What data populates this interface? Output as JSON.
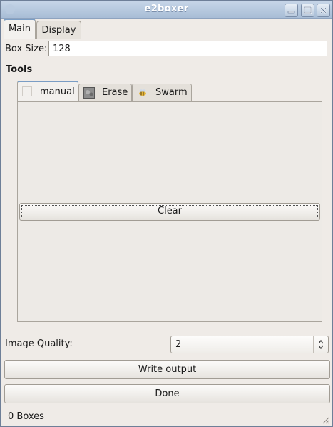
{
  "window": {
    "title": "e2boxer"
  },
  "tabs": [
    {
      "label": "Main"
    },
    {
      "label": "Display"
    }
  ],
  "box_size": {
    "label": "Box Size:",
    "value": "128"
  },
  "tools": {
    "heading": "Tools",
    "tabs": [
      {
        "label": "manual",
        "icon": "blank-icon"
      },
      {
        "label": "Erase",
        "icon": "eraser-image-icon"
      },
      {
        "label": "Swarm",
        "icon": "bee-icon"
      }
    ],
    "clear_label": "Clear"
  },
  "image_quality": {
    "label": "Image Quality:",
    "value": "2"
  },
  "write_output_label": "Write output",
  "done_label": "Done",
  "status": {
    "text": "0 Boxes"
  },
  "colors": {
    "titlebar": "#b3c6dd",
    "active_tab_accent": "#7a9dc4",
    "window_bg": "#efebe7"
  }
}
